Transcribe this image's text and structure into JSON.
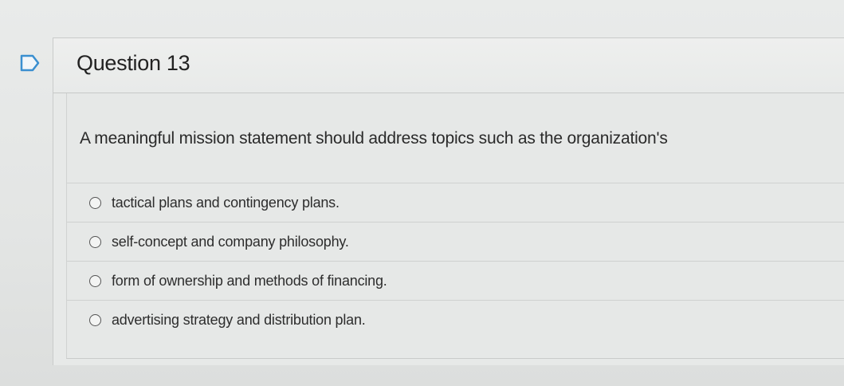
{
  "question": {
    "title": "Question 13",
    "prompt": "A meaningful mission statement should address topics such as the organization's",
    "options": [
      {
        "label": "tactical plans and contingency plans."
      },
      {
        "label": "self-concept and company philosophy."
      },
      {
        "label": "form of ownership and methods of financing."
      },
      {
        "label": "advertising strategy and distribution plan."
      }
    ]
  },
  "icons": {
    "flag": "flag-outline-icon"
  },
  "colors": {
    "flag": "#3a8fd0",
    "background": "#e6e8e7"
  }
}
